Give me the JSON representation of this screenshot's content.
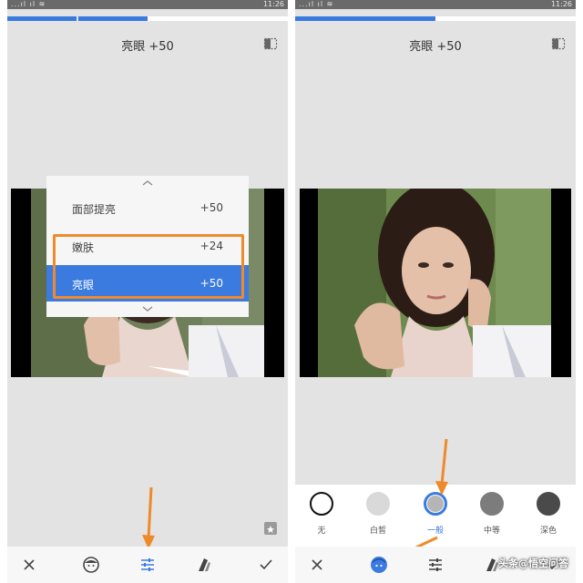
{
  "colors": {
    "accent": "#3b7be0",
    "highlight": "#ef8a2a",
    "panel_bg": "#e3e3e3"
  },
  "left": {
    "status": {
      "signal": "...ıl ıl ≋",
      "time": "11:26"
    },
    "progress_fraction": 0.5,
    "title": "亮眼 +50",
    "menu": {
      "items": [
        {
          "label": "面部提亮",
          "value": "+50",
          "selected": false
        },
        {
          "label": "嫩肤",
          "value": "+24",
          "selected": false
        },
        {
          "label": "亮眼",
          "value": "+50",
          "selected": true
        }
      ]
    },
    "toolbar": {
      "icons": [
        "close-icon",
        "face-icon",
        "sliders-icon",
        "styles-icon",
        "check-icon"
      ],
      "active": "sliders-icon"
    }
  },
  "right": {
    "status": {
      "signal": "...ıl ıl ≋",
      "time": "11:26"
    },
    "progress_fraction": 0.5,
    "title": "亮眼 +50",
    "styles": [
      {
        "label": "无",
        "fill": "#ffffff",
        "border": "#111111",
        "selected": false
      },
      {
        "label": "白皙",
        "fill": "#d9d9d9",
        "border": "#d9d9d9",
        "selected": false
      },
      {
        "label": "一般",
        "fill": "#b5b5b5",
        "border": "#3b7be0",
        "selected": true
      },
      {
        "label": "中等",
        "fill": "#7c7c7c",
        "border": "#7c7c7c",
        "selected": false
      },
      {
        "label": "深色",
        "fill": "#4a4a4a",
        "border": "#4a4a4a",
        "selected": false
      }
    ],
    "toolbar": {
      "icons": [
        "close-icon",
        "face-icon",
        "sliders-icon",
        "styles-icon",
        "check-icon"
      ],
      "active": "face-icon"
    }
  },
  "watermark": "头条@悟空问答"
}
